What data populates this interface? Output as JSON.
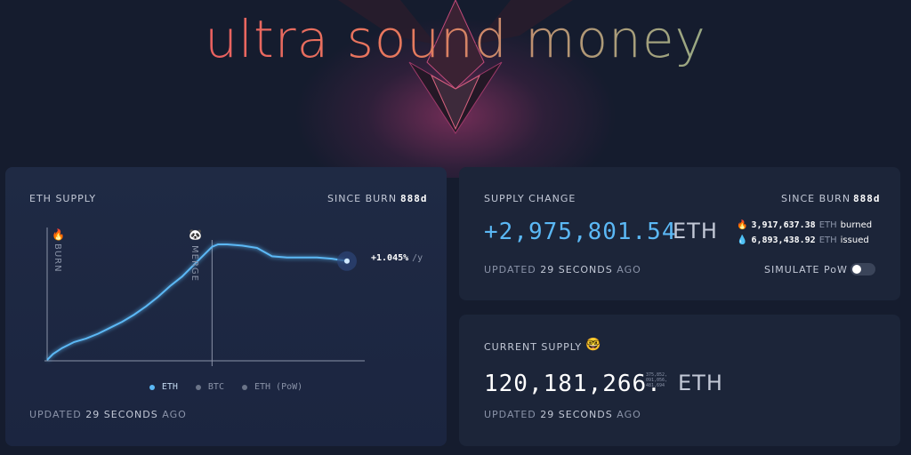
{
  "title": "ultra sound money",
  "eth_supply_card": {
    "title": "ETH SUPPLY",
    "since_label": "SINCE BURN",
    "since_value": "888d",
    "burn_marker": "BURN",
    "merge_marker": "MERGE",
    "rate": "+1.045%",
    "rate_unit": "/y",
    "legend": [
      {
        "label": "ETH",
        "color": "#5bb8f5"
      },
      {
        "label": "BTC",
        "color": "#6b7488"
      },
      {
        "label": "ETH (PoW)",
        "color": "#6b7488"
      }
    ],
    "updated_prefix": "UPDATED",
    "updated_value": "29 SECONDS",
    "updated_suffix": "AGO"
  },
  "chart_data": {
    "type": "line",
    "title": "",
    "xlabel": "",
    "ylabel": "",
    "series": [
      {
        "x": [
          0,
          0.02,
          0.05,
          0.09,
          0.13,
          0.17,
          0.21,
          0.25,
          0.29,
          0.33,
          0.37,
          0.41,
          0.45,
          0.49,
          0.53,
          0.55,
          0.57,
          0.6,
          0.65,
          0.7,
          0.75,
          0.8,
          0.85,
          0.9,
          0.95,
          1.0
        ],
        "y": [
          0.0,
          0.05,
          0.1,
          0.15,
          0.18,
          0.22,
          0.27,
          0.32,
          0.38,
          0.45,
          0.53,
          0.62,
          0.7,
          0.8,
          0.9,
          0.95,
          0.97,
          0.97,
          0.96,
          0.94,
          0.87,
          0.86,
          0.86,
          0.86,
          0.85,
          0.83
        ]
      }
    ],
    "markers": [
      {
        "label": "BURN",
        "x": 0
      },
      {
        "label": "MERGE",
        "x": 0.55
      }
    ]
  },
  "supply_change_card": {
    "title": "SUPPLY CHANGE",
    "since_label": "SINCE BURN",
    "since_value": "888d",
    "value": "+2,975,801.54",
    "unit": "ETH",
    "burned_value": "3,917,637.38",
    "burned_unit": "ETH",
    "burned_label": "burned",
    "issued_value": "6,893,438.92",
    "issued_unit": "ETH",
    "issued_label": "issued",
    "updated_prefix": "UPDATED",
    "updated_value": "29 SECONDS",
    "updated_suffix": "AGO",
    "simulate_label": "SIMULATE PoW",
    "simulate_on": false
  },
  "current_supply_card": {
    "title": "CURRENT SUPPLY",
    "value": "120,181,266.",
    "unit": "ETH",
    "tiny_digits": [
      "375,852,",
      "091,056,",
      "481,694"
    ],
    "updated_prefix": "UPDATED",
    "updated_value": "29 SECONDS",
    "updated_suffix": "AGO"
  },
  "colors": {
    "accent_blue": "#5bb8f5",
    "background": "#151c2e",
    "card": "#1c2539"
  }
}
